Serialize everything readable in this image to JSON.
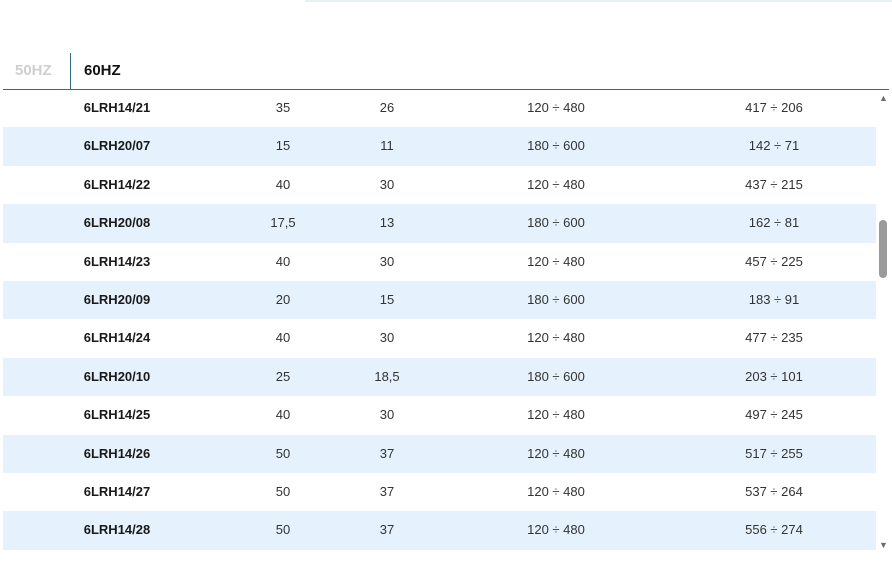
{
  "tabs": {
    "hz50_label": "50HZ",
    "hz60_label": "60HZ",
    "active": "60HZ"
  },
  "colors": {
    "row_alt": "#e5f1fc",
    "tab_border": "#2c6e86",
    "inactive_tab": "#cfcfcf"
  },
  "table": {
    "rows": [
      {
        "model": "6LRH14/21",
        "kw": "35",
        "hp": "26",
        "flow": "120 ÷ 480",
        "head": "417 ÷ 206"
      },
      {
        "model": "6LRH20/07",
        "kw": "15",
        "hp": "11",
        "flow": "180 ÷ 600",
        "head": "142 ÷ 71"
      },
      {
        "model": "6LRH14/22",
        "kw": "40",
        "hp": "30",
        "flow": "120 ÷ 480",
        "head": "437 ÷ 215"
      },
      {
        "model": "6LRH20/08",
        "kw": "17,5",
        "hp": "13",
        "flow": "180 ÷ 600",
        "head": "162 ÷ 81"
      },
      {
        "model": "6LRH14/23",
        "kw": "40",
        "hp": "30",
        "flow": "120 ÷ 480",
        "head": "457 ÷ 225"
      },
      {
        "model": "6LRH20/09",
        "kw": "20",
        "hp": "15",
        "flow": "180 ÷ 600",
        "head": "183 ÷ 91"
      },
      {
        "model": "6LRH14/24",
        "kw": "40",
        "hp": "30",
        "flow": "120 ÷ 480",
        "head": "477 ÷ 235"
      },
      {
        "model": "6LRH20/10",
        "kw": "25",
        "hp": "18,5",
        "flow": "180 ÷ 600",
        "head": "203 ÷ 101"
      },
      {
        "model": "6LRH14/25",
        "kw": "40",
        "hp": "30",
        "flow": "120 ÷ 480",
        "head": "497 ÷ 245"
      },
      {
        "model": "6LRH14/26",
        "kw": "50",
        "hp": "37",
        "flow": "120 ÷ 480",
        "head": "517 ÷ 255"
      },
      {
        "model": "6LRH14/27",
        "kw": "50",
        "hp": "37",
        "flow": "120 ÷ 480",
        "head": "537 ÷ 264"
      },
      {
        "model": "6LRH14/28",
        "kw": "50",
        "hp": "37",
        "flow": "120 ÷ 480",
        "head": "556 ÷ 274"
      }
    ]
  },
  "scrollbar": {
    "up_icon": "triangle-up-icon",
    "down_icon": "triangle-down-icon"
  }
}
